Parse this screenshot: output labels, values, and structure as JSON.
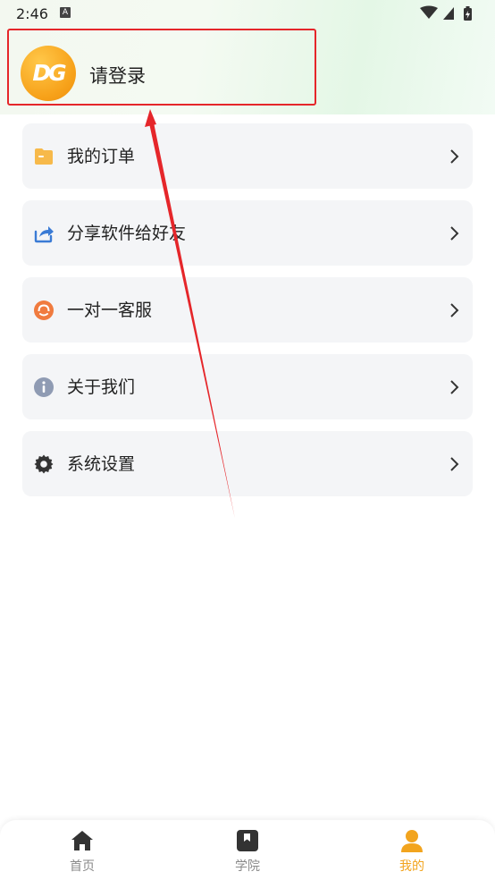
{
  "status_bar": {
    "time": "2:46",
    "notification_icon": "A"
  },
  "profile": {
    "avatar_text": "DG",
    "login_label": "请登录"
  },
  "menu": {
    "items": [
      {
        "label": "我的订单",
        "icon": "folder-icon",
        "color": "#f7b94a"
      },
      {
        "label": "分享软件给好友",
        "icon": "share-icon",
        "color": "#3a7bd5"
      },
      {
        "label": "一对一客服",
        "icon": "headset-icon",
        "color": "#f07b3f"
      },
      {
        "label": "关于我们",
        "icon": "info-icon",
        "color": "#8f9bb3"
      },
      {
        "label": "系统设置",
        "icon": "gear-icon",
        "color": "#333333"
      }
    ]
  },
  "tabbar": {
    "tabs": [
      {
        "label": "首页",
        "icon": "home-icon",
        "active": false
      },
      {
        "label": "学院",
        "icon": "book-icon",
        "active": false
      },
      {
        "label": "我的",
        "icon": "person-icon",
        "active": true
      }
    ]
  },
  "colors": {
    "accent": "#f2a41e",
    "highlight_border": "#e5262a",
    "menu_bg": "#f4f5f7"
  }
}
